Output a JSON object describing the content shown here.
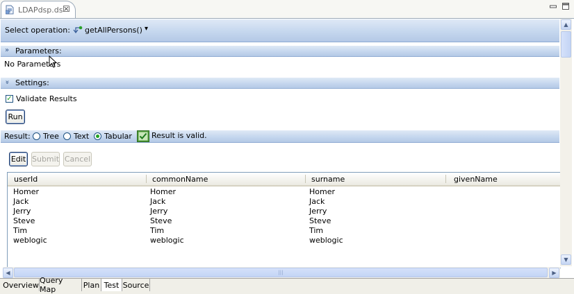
{
  "editor": {
    "tab_title": "LDAPdsp.ds",
    "close_glyph": "☒"
  },
  "operation": {
    "label": "Select operation:",
    "selected": "getAllPersons()",
    "dropdown_glyph": "▾"
  },
  "parameters": {
    "header": "Parameters:",
    "twisty_glyph": "»",
    "message": "No Parameters"
  },
  "settings": {
    "header": "Settings:",
    "twisty_glyph": "»",
    "validate_label": "Validate Results",
    "validate_checked": true,
    "check_glyph": "✓",
    "run_label": "Run"
  },
  "result": {
    "label": "Result:",
    "options": [
      "Tree",
      "Text",
      "Tabular"
    ],
    "selected": "Tabular",
    "status": "Result is valid.",
    "status_color": "#2e9e2e"
  },
  "actions": {
    "edit": "Edit",
    "submit": "Submit",
    "cancel": "Cancel"
  },
  "table": {
    "columns": [
      "userId",
      "commonName",
      "surname",
      "givenName"
    ],
    "rows": [
      [
        "Homer",
        "Homer",
        "Homer",
        ""
      ],
      [
        "Jack",
        "Jack",
        "Jack",
        ""
      ],
      [
        "Jerry",
        "Jerry",
        "Jerry",
        ""
      ],
      [
        "Steve",
        "Steve",
        "Steve",
        ""
      ],
      [
        "Tim",
        "Tim",
        "Tim",
        ""
      ],
      [
        "weblogic",
        "weblogic",
        "weblogic",
        ""
      ]
    ]
  },
  "scrollbar": {
    "up": "▲",
    "down": "▼",
    "left": "◀",
    "right": "▶",
    "grip": "|||"
  },
  "bottom_tabs": [
    {
      "label": "Overview",
      "active": false
    },
    {
      "label": "Query Map",
      "active": false
    },
    {
      "label": "Plan",
      "active": false
    },
    {
      "label": "Test",
      "active": true
    },
    {
      "label": "Source",
      "active": false
    }
  ],
  "colors": {
    "accent": "#b4c9e6",
    "valid_green": "#21a121",
    "border": "#7f9db9"
  },
  "icons": [
    "file-icon",
    "close-icon",
    "minimize-icon",
    "maximize-icon",
    "operation-icon",
    "dropdown-arrow-icon",
    "valid-check-icon",
    "mouse-pointer-icon"
  ]
}
